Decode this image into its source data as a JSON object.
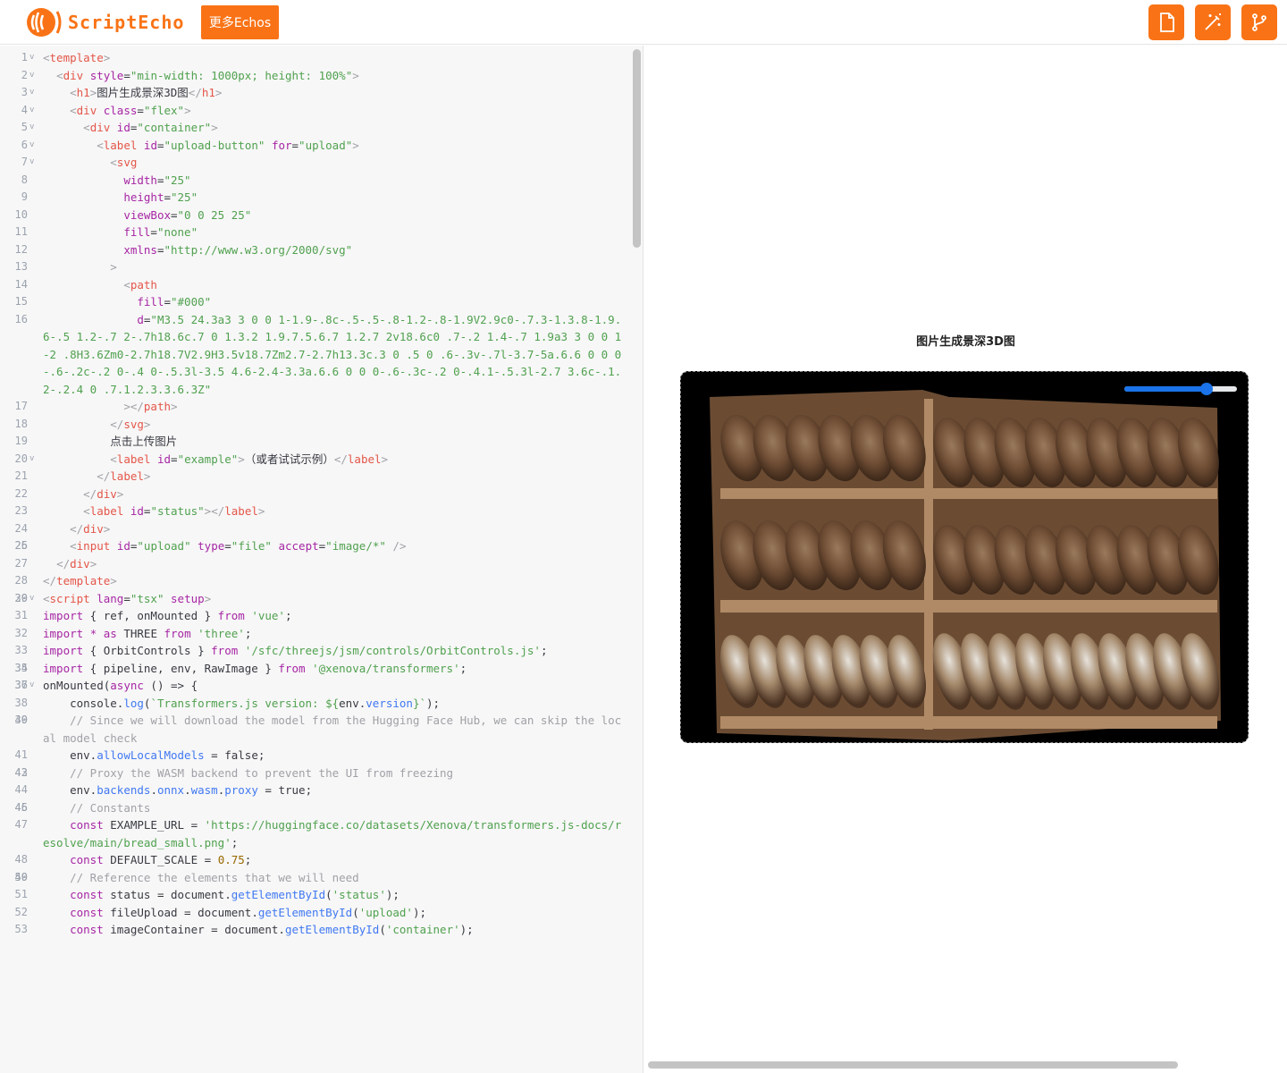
{
  "header": {
    "logo_text": "ScriptEcho",
    "more_label": "更多Echos",
    "accent": "#f97316",
    "tools": [
      "file-icon",
      "magic-wand-icon",
      "git-branch-icon"
    ]
  },
  "editor": {
    "lines": [
      {
        "n": "1",
        "fold": true,
        "html": "<span class=\"p\">&lt;</span><span class=\"t\">template</span><span class=\"p\">&gt;</span>"
      },
      {
        "n": "2",
        "fold": true,
        "html": "  <span class=\"p\">&lt;</span><span class=\"t\">div</span> <span class=\"a\">style</span>=<span class=\"s\">\"min-width: 1000px; height: 100%\"</span><span class=\"p\">&gt;</span>"
      },
      {
        "n": "3",
        "fold": true,
        "html": "    <span class=\"p\">&lt;</span><span class=\"t\">h1</span><span class=\"p\">&gt;</span>图片生成景深3D图<span class=\"p\">&lt;/</span><span class=\"t\">h1</span><span class=\"p\">&gt;</span>"
      },
      {
        "n": "4",
        "fold": true,
        "html": "    <span class=\"p\">&lt;</span><span class=\"t\">div</span> <span class=\"a\">class</span>=<span class=\"s\">\"flex\"</span><span class=\"p\">&gt;</span>"
      },
      {
        "n": "5",
        "fold": true,
        "html": "      <span class=\"p\">&lt;</span><span class=\"t\">div</span> <span class=\"a\">id</span>=<span class=\"s\">\"container\"</span><span class=\"p\">&gt;</span>"
      },
      {
        "n": "6",
        "fold": true,
        "html": "        <span class=\"p\">&lt;</span><span class=\"t\">label</span> <span class=\"a\">id</span>=<span class=\"s\">\"upload-button\"</span> <span class=\"a\">for</span>=<span class=\"s\">\"upload\"</span><span class=\"p\">&gt;</span>"
      },
      {
        "n": "7",
        "fold": true,
        "html": "          <span class=\"p\">&lt;</span><span class=\"t\">svg</span>"
      },
      {
        "n": "8",
        "fold": false,
        "html": "            <span class=\"a\">width</span>=<span class=\"s\">\"25\"</span>"
      },
      {
        "n": "9",
        "fold": false,
        "html": "            <span class=\"a\">height</span>=<span class=\"s\">\"25\"</span>"
      },
      {
        "n": "10",
        "fold": false,
        "html": "            <span class=\"a\">viewBox</span>=<span class=\"s\">\"0 0 25 25\"</span>"
      },
      {
        "n": "11",
        "fold": false,
        "html": "            <span class=\"a\">fill</span>=<span class=\"s\">\"none\"</span>"
      },
      {
        "n": "12",
        "fold": false,
        "html": "            <span class=\"a\">xmlns</span>=<span class=\"s\">\"http://www.w3.org/2000/svg\"</span>"
      },
      {
        "n": "13",
        "fold": false,
        "html": "          <span class=\"p\">&gt;</span>"
      },
      {
        "n": "14",
        "fold": false,
        "html": "            <span class=\"p\">&lt;</span><span class=\"t\">path</span>"
      },
      {
        "n": "15",
        "fold": false,
        "html": "              <span class=\"a\">fill</span>=<span class=\"s\">\"#000\"</span>"
      },
      {
        "n": "16",
        "fold": false,
        "html": "              <span class=\"a\">d</span>=<span class=\"s\">\"M3.5 24.3a3 3 0 0 1-1.9-.8c-.5-.5-.8-1.2-.8-1.9V2.9c0-.7.3-1.3.8-1.9.6-.5 1.2-.7 2-.7h18.6c.7 0 1.3.2 1.9.7.5.6.7 1.2.7 2v18.6c0 .7-.2 1.4-.7 1.9a3 3 0 0 1-2 .8H3.6Zm0-2.7h18.7V2.9H3.5v18.7Zm2.7-2.7h13.3c.3 0 .5 0 .6-.3v-.7l-3.7-5a.6.6 0 0 0-.6-.2c-.2 0-.4 0-.5.3l-3.5 4.6-2.4-3.3a.6.6 0 0 0-.6-.3c-.2 0-.4.1-.5.3l-2.7 3.6c-.1.2-.2.4 0 .7.1.2.3.3.6.3Z\"</span>"
      },
      {
        "n": "17",
        "fold": false,
        "html": "            <span class=\"p\">&gt;&lt;/</span><span class=\"t\">path</span><span class=\"p\">&gt;</span>"
      },
      {
        "n": "18",
        "fold": false,
        "html": "          <span class=\"p\">&lt;/</span><span class=\"t\">svg</span><span class=\"p\">&gt;</span>"
      },
      {
        "n": "19",
        "fold": false,
        "html": "          点击上传图片"
      },
      {
        "n": "20",
        "fold": true,
        "html": "          <span class=\"p\">&lt;</span><span class=\"t\">label</span> <span class=\"a\">id</span>=<span class=\"s\">\"example\"</span><span class=\"p\">&gt;</span>（或者试试示例）<span class=\"p\">&lt;/</span><span class=\"t\">label</span><span class=\"p\">&gt;</span>"
      },
      {
        "n": "21",
        "fold": false,
        "html": "        <span class=\"p\">&lt;/</span><span class=\"t\">label</span><span class=\"p\">&gt;</span>"
      },
      {
        "n": "22",
        "fold": false,
        "html": "      <span class=\"p\">&lt;/</span><span class=\"t\">div</span><span class=\"p\">&gt;</span>"
      },
      {
        "n": "23",
        "fold": false,
        "html": "      <span class=\"p\">&lt;</span><span class=\"t\">label</span> <span class=\"a\">id</span>=<span class=\"s\">\"status\"</span><span class=\"p\">&gt;&lt;/</span><span class=\"t\">label</span><span class=\"p\">&gt;</span>"
      },
      {
        "n": "24",
        "fold": false,
        "html": "    <span class=\"p\">&lt;/</span><span class=\"t\">div</span><span class=\"p\">&gt;</span>"
      },
      {
        "n": "25",
        "fold": false,
        "html": ""
      },
      {
        "n": "26",
        "fold": false,
        "html": "    <span class=\"p\">&lt;</span><span class=\"t\">input</span> <span class=\"a\">id</span>=<span class=\"s\">\"upload\"</span> <span class=\"a\">type</span>=<span class=\"s\">\"file\"</span> <span class=\"a\">accept</span>=<span class=\"s\">\"image/*\"</span> <span class=\"p\">/&gt;</span>"
      },
      {
        "n": "27",
        "fold": false,
        "html": "  <span class=\"p\">&lt;/</span><span class=\"t\">div</span><span class=\"p\">&gt;</span>"
      },
      {
        "n": "28",
        "fold": false,
        "html": "<span class=\"p\">&lt;/</span><span class=\"t\">template</span><span class=\"p\">&gt;</span>"
      },
      {
        "n": "29",
        "fold": false,
        "html": ""
      },
      {
        "n": "30",
        "fold": true,
        "html": "<span class=\"p\">&lt;</span><span class=\"t\">script</span> <span class=\"a\">lang</span>=<span class=\"s\">\"tsx\"</span> <span class=\"a\">setup</span><span class=\"p\">&gt;</span>"
      },
      {
        "n": "31",
        "fold": false,
        "html": "<span class=\"k\">import</span> { ref, onMounted } <span class=\"k\">from</span> <span class=\"s\">'vue'</span>;"
      },
      {
        "n": "32",
        "fold": false,
        "html": "<span class=\"k\">import</span> <span class=\"k\">*</span> <span class=\"k\">as</span> THREE <span class=\"k\">from</span> <span class=\"s\">'three'</span>;"
      },
      {
        "n": "33",
        "fold": false,
        "html": "<span class=\"k\">import</span> { OrbitControls } <span class=\"k\">from</span> <span class=\"s\">'/sfc/threejs/jsm/controls/OrbitControls.js'</span>;"
      },
      {
        "n": "34",
        "fold": false,
        "html": ""
      },
      {
        "n": "35",
        "fold": false,
        "html": "<span class=\"k\">import</span> { pipeline, env, RawImage } <span class=\"k\">from</span> <span class=\"s\">'@xenova/transformers'</span>;"
      },
      {
        "n": "36",
        "fold": false,
        "html": ""
      },
      {
        "n": "37",
        "fold": true,
        "html": "onMounted(<span class=\"k\">async</span> () =&gt; {"
      },
      {
        "n": "38",
        "fold": false,
        "html": "    console.<span class=\"f\">log</span>(<span class=\"s\">`Transformers.js version: ${</span>env.<span class=\"f\">version</span><span class=\"s\">}`</span>);"
      },
      {
        "n": "39",
        "fold": false,
        "html": ""
      },
      {
        "n": "40",
        "fold": false,
        "html": "    <span class=\"c\">// Since we will download the model from the Hugging Face Hub, we can skip the local model check</span>"
      },
      {
        "n": "41",
        "fold": false,
        "html": "    env.<span class=\"f\">allowLocalModels</span> = false;"
      },
      {
        "n": "42",
        "fold": false,
        "html": ""
      },
      {
        "n": "43",
        "fold": false,
        "html": "    <span class=\"c\">// Proxy the WASM backend to prevent the UI from freezing</span>"
      },
      {
        "n": "44",
        "fold": false,
        "html": "    env.<span class=\"f\">backends</span>.<span class=\"f\">onnx</span>.<span class=\"f\">wasm</span>.<span class=\"f\">proxy</span> = true;"
      },
      {
        "n": "45",
        "fold": false,
        "html": ""
      },
      {
        "n": "46",
        "fold": false,
        "html": "    <span class=\"c\">// Constants</span>"
      },
      {
        "n": "47",
        "fold": false,
        "html": "    <span class=\"k\">const</span> EXAMPLE_URL = <span class=\"s\">'https://huggingface.co/datasets/Xenova/transformers.js-docs/resolve/main/bread_small.png'</span>;"
      },
      {
        "n": "48",
        "fold": false,
        "html": "    <span class=\"k\">const</span> DEFAULT_SCALE = <span class=\"n\">0.75</span>;"
      },
      {
        "n": "49",
        "fold": false,
        "html": ""
      },
      {
        "n": "50",
        "fold": false,
        "html": "    <span class=\"c\">// Reference the elements that we will need</span>"
      },
      {
        "n": "51",
        "fold": false,
        "html": "    <span class=\"k\">const</span> status = document.<span class=\"f\">getElementById</span>(<span class=\"s\">'status'</span>);"
      },
      {
        "n": "52",
        "fold": false,
        "html": "    <span class=\"k\">const</span> fileUpload = document.<span class=\"f\">getElementById</span>(<span class=\"s\">'upload'</span>);"
      },
      {
        "n": "53",
        "fold": false,
        "html": "    <span class=\"k\">const</span> imageContainer = document.<span class=\"f\">getElementById</span>(<span class=\"s\">'container'</span>);"
      }
    ]
  },
  "preview": {
    "title": "图片生成景深3D图",
    "slider_value": 0.73,
    "slider_color": "#1a73e8"
  }
}
